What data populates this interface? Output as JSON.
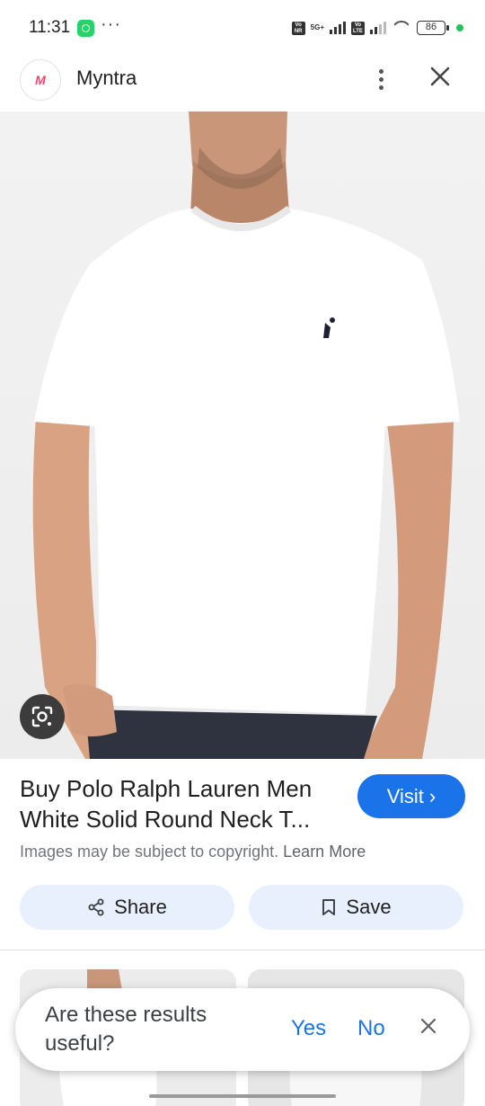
{
  "status_bar": {
    "time": "11:31",
    "menu_dots": "···",
    "network_badge_1": "Vo NR",
    "network_badge_2": "Vo LTE",
    "network_type": "5G+",
    "battery": "86"
  },
  "header": {
    "site_logo_text": "M",
    "site_name": "Myntra"
  },
  "product": {
    "title": "Buy Polo Ralph Lauren Men White Solid Round Neck T...",
    "visit_label": "Visit",
    "visit_arrow": "›",
    "copyright_text": "Images may be subject to copyright.",
    "learn_more": "Learn More",
    "share_label": "Share",
    "save_label": "Save"
  },
  "feedback": {
    "question": "Are these results useful?",
    "yes_label": "Yes",
    "no_label": "No",
    "close_symbol": "×"
  },
  "colors": {
    "accent": "#1a73e8",
    "pill_bg": "#e8f0fe",
    "brand": "#ff3f6c"
  }
}
